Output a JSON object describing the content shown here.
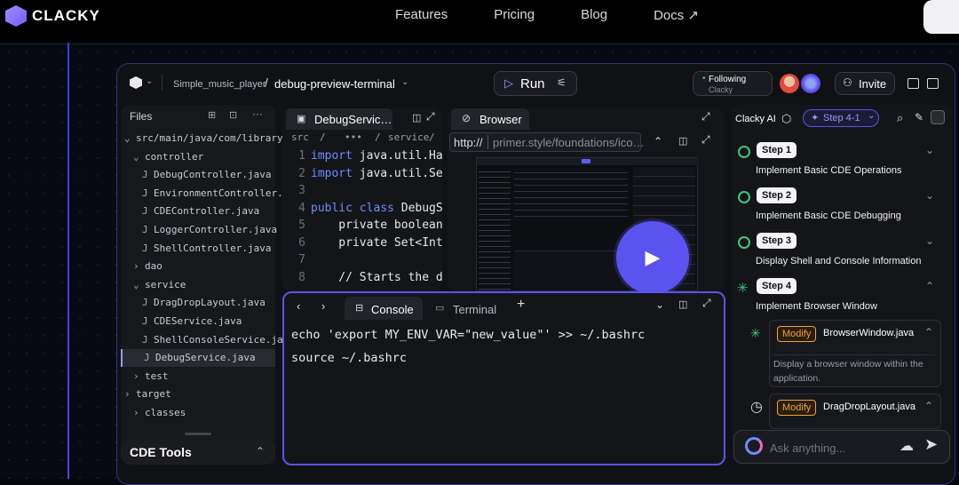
{
  "brand": {
    "name": "CLACKY"
  },
  "nav": {
    "features": "Features",
    "pricing": "Pricing",
    "blog": "Blog",
    "docs": "Docs ↗"
  },
  "topbar": {
    "project": "Simple_music_player",
    "branch": "debug-preview-terminal",
    "run": "Run",
    "following": "Following",
    "following_sub": "Clacky",
    "invite": "Invite"
  },
  "files": {
    "title": "Files",
    "items": [
      {
        "label": "src/main/java/com/library",
        "type": "folder-open"
      },
      {
        "label": "controller",
        "type": "folder-open"
      },
      {
        "label": "DebugController.java",
        "type": "file"
      },
      {
        "label": "EnvironmentController.j…",
        "type": "file"
      },
      {
        "label": "CDEController.java",
        "type": "file"
      },
      {
        "label": "LoggerController.java",
        "type": "file"
      },
      {
        "label": "ShellController.java",
        "type": "file"
      },
      {
        "label": "dao",
        "type": "folder"
      },
      {
        "label": "service",
        "type": "folder-open"
      },
      {
        "label": "DragDropLayout.java",
        "type": "file"
      },
      {
        "label": "CDEService.java",
        "type": "file"
      },
      {
        "label": "ShellConsoleService.jav…",
        "type": "file"
      },
      {
        "label": "DebugService.java",
        "type": "file",
        "selected": true
      },
      {
        "label": "test",
        "type": "folder"
      },
      {
        "label": "target",
        "type": "folder"
      },
      {
        "label": "classes",
        "type": "folder"
      }
    ],
    "cde_tools": "CDE Tools"
  },
  "editor": {
    "tab": "DebugServic…",
    "breadcrumb": {
      "a": "src",
      "sep": "/",
      "b": "•••",
      "c": "service",
      "d": "/"
    },
    "lines": [
      {
        "n": "1",
        "kw": "import",
        "rest": " java.util.Ha"
      },
      {
        "n": "2",
        "kw": "import",
        "rest": " java.util.Se"
      },
      {
        "n": "3",
        "kw": "",
        "rest": ""
      },
      {
        "n": "4",
        "kw": "public class",
        "rest": " DebugS"
      },
      {
        "n": "5",
        "kw": "",
        "rest": "    private boolean"
      },
      {
        "n": "6",
        "kw": "",
        "rest": "    private Set<Int"
      },
      {
        "n": "7",
        "kw": "",
        "rest": ""
      },
      {
        "n": "8",
        "kw": "",
        "rest": "    // Starts the d"
      }
    ]
  },
  "browser": {
    "tab": "Browser",
    "scheme": "http://",
    "url": "primer.style/foundations/ico…"
  },
  "console": {
    "tab_console": "Console",
    "tab_terminal": "Terminal",
    "lines": [
      "echo 'export MY_ENV_VAR=\"new_value\"' >> ~/.bashrc",
      "source ~/.bashrc"
    ]
  },
  "ai": {
    "title": "Clacky AI",
    "step_tag": "Step 4-1",
    "steps": [
      {
        "badge": "Step 1",
        "desc": "Implement Basic CDE Operations",
        "status": "done"
      },
      {
        "badge": "Step 2",
        "desc": "Implement Basic CDE Debugging",
        "status": "done"
      },
      {
        "badge": "Step 3",
        "desc": "Display Shell and Console Information",
        "status": "done"
      },
      {
        "badge": "Step 4",
        "desc": "Implement Browser Window",
        "status": "running"
      }
    ],
    "tasks": [
      {
        "action": "Modify",
        "file": "BrowserWindow.java",
        "desc": "Display a browser window within the application."
      },
      {
        "action": "Modify",
        "file": "DragDropLayout.java"
      }
    ],
    "ask_placeholder": "Ask anything..."
  }
}
